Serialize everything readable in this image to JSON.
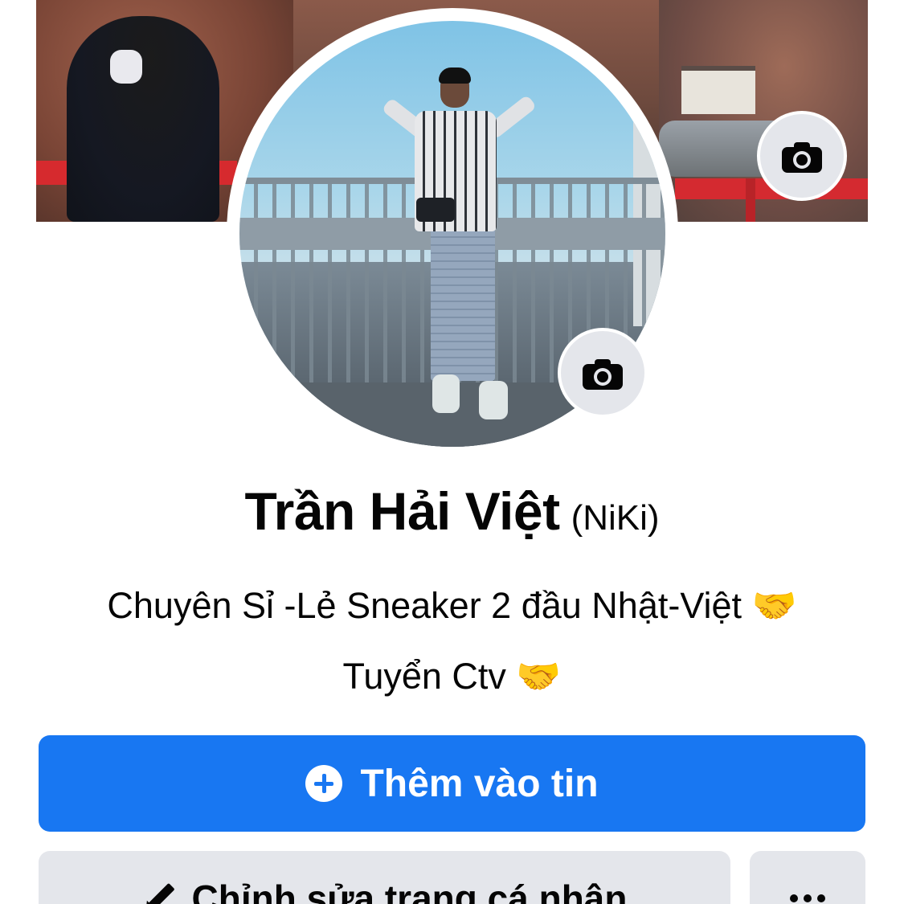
{
  "profile": {
    "name": "Trần Hải Việt",
    "nickname": "(NiKi)",
    "bio_line1": "Chuyên Sỉ -Lẻ Sneaker 2 đầu Nhật-Việt 🤝",
    "bio_line2": "Tuyển Ctv 🤝"
  },
  "actions": {
    "add_story_label": "Thêm vào tin",
    "edit_profile_label": "Chỉnh sửa trang cá nhân"
  },
  "icons": {
    "cover_camera": "camera-icon",
    "profile_camera": "camera-icon",
    "add": "plus-circle-icon",
    "edit": "pencil-icon",
    "more": "more-dots-icon"
  },
  "colors": {
    "primary": "#1877f2",
    "secondary_button": "#e4e6eb",
    "text": "#050505"
  }
}
